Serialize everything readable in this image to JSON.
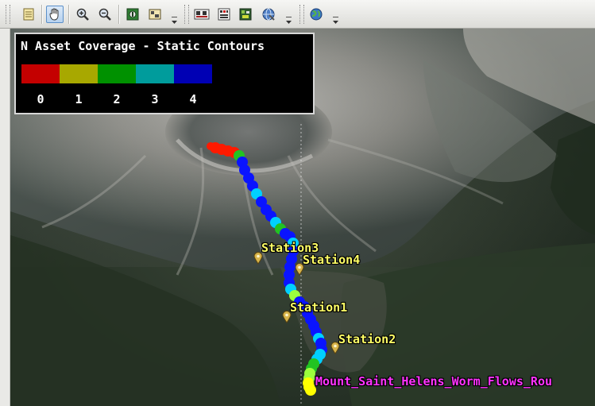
{
  "toolbar": {
    "groups": [
      {
        "buttons": [
          {
            "icon": "notepad-icon",
            "active": false
          },
          {
            "icon": "pan-hand-icon",
            "active": true
          },
          {
            "icon": "zoom-in-icon",
            "active": false
          },
          {
            "icon": "zoom-out-icon",
            "active": false
          },
          {
            "icon": "map-view-icon",
            "active": false
          },
          {
            "icon": "layer-image-icon",
            "active": false
          }
        ]
      },
      {
        "buttons": [
          {
            "icon": "label-ab-icon",
            "active": false
          },
          {
            "icon": "grid-chart-icon",
            "active": false
          },
          {
            "icon": "terrain-map-icon",
            "active": false
          },
          {
            "icon": "globe-settings-icon",
            "active": false
          }
        ]
      },
      {
        "buttons": [
          {
            "icon": "globe-icon",
            "active": false
          }
        ]
      }
    ]
  },
  "legend": {
    "title": "N Asset Coverage - Static Contours",
    "entries": [
      {
        "label": "0",
        "color": "#c40000"
      },
      {
        "label": "1",
        "color": "#a8a800"
      },
      {
        "label": "2",
        "color": "#009100"
      },
      {
        "label": "3",
        "color": "#009c9c"
      },
      {
        "label": "4",
        "color": "#0000b4"
      }
    ]
  },
  "map": {
    "stations": [
      {
        "name": "Station3"
      },
      {
        "name": "Station4"
      },
      {
        "name": "Station1"
      },
      {
        "name": "Station2"
      }
    ],
    "route_label": "Mount_Saint_Helens_Worm_Flows_Rou",
    "coverage_colors": {
      "red": "#ff1a00",
      "green": "#22c322",
      "cyan": "#00d0ff",
      "blue": "#0a14ff",
      "yellow": "#ffff00",
      "yellow_green": "#9cff3c"
    }
  }
}
